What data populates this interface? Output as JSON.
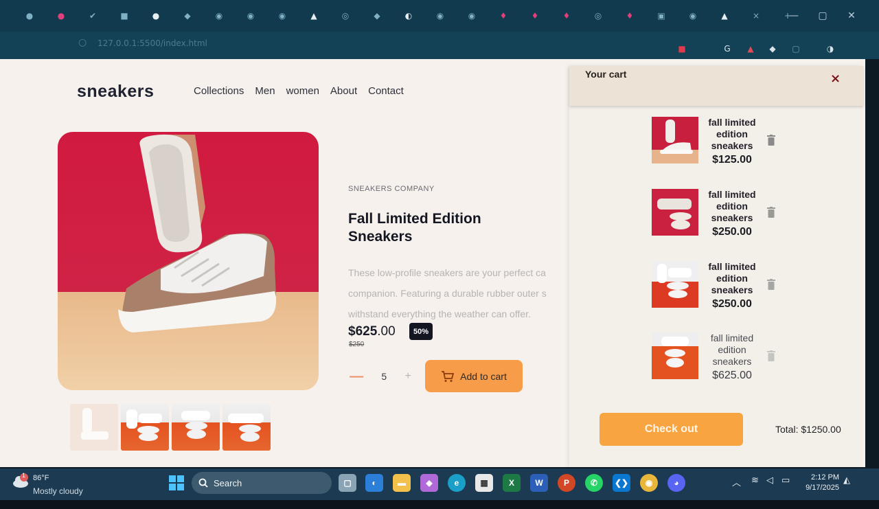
{
  "browser": {
    "url": "127.0.0.1:5500/index.html",
    "colors": {
      "tabbar": "#123a4f",
      "addressbar": "#134257"
    }
  },
  "site": {
    "logo": "sneakers",
    "nav": [
      "Collections",
      "Men",
      "women",
      "About",
      "Contact"
    ]
  },
  "product": {
    "company": "SNEAKERS COMPANY",
    "title": "Fall Limited Edition Sneakers",
    "description_lines": [
      "These low-profile sneakers are your perfect ca",
      "companion. Featuring a durable rubber outer s",
      "withstand everything the weather can offer."
    ],
    "price_currency": "$",
    "price_whole": "625",
    "price_cents": ".00",
    "discount_badge": "50%",
    "old_price": "$250",
    "quantity": "5",
    "minus_label": "—",
    "plus_label": "+",
    "add_to_cart_label": "Add to cart",
    "accent_color": "#f79c48"
  },
  "cart": {
    "title": "Your cart",
    "close_label": "×",
    "items": [
      {
        "name": "fall limited edition sneakers",
        "price": "$125.00"
      },
      {
        "name": "fall limited edition sneakers",
        "price": "$250.00"
      },
      {
        "name": "fall limited edition sneakers",
        "price": "$250.00"
      },
      {
        "name": "fall limited edition sneakers",
        "price": "$625.00"
      }
    ],
    "checkout_label": "Check out",
    "total_label": "Total: $1250.00"
  },
  "taskbar": {
    "weather_badge": "1",
    "weather_temp": "86°F",
    "weather_condition": "Mostly cloudy",
    "search_label": "Search",
    "time": "2:12 PM",
    "date": "9/17/2025",
    "apps": [
      "windows-start",
      "task-view",
      "copilot",
      "file-explorer",
      "photos",
      "edge",
      "store",
      "excel",
      "word",
      "powerpoint",
      "whatsapp",
      "vscode",
      "chrome",
      "discord"
    ]
  }
}
